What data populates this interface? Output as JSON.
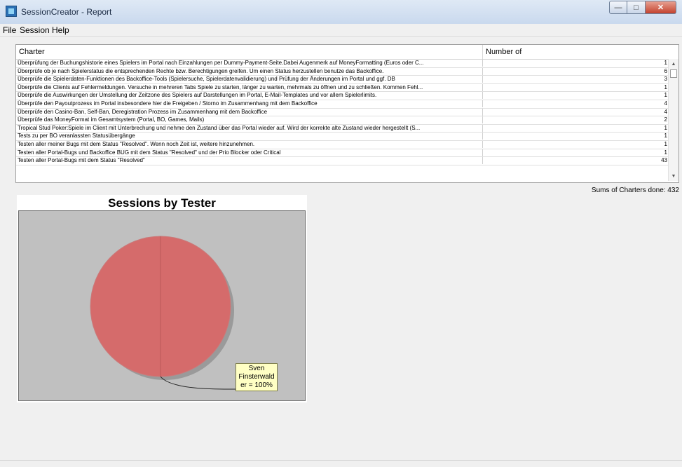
{
  "window": {
    "title": "SessionCreator - Report"
  },
  "menu": {
    "file": "File",
    "session": "Session",
    "help": "Help"
  },
  "table": {
    "headers": {
      "charter": "Charter",
      "number_of": "Number of"
    },
    "rows": [
      {
        "charter": "Überprüfung der Buchungshistorie eines Spielers im Portal nach Einzahlungen per Dummy-Payment-Seite.Dabei Augenmerk auf MoneyFormatting (Euros oder C...",
        "count": "1"
      },
      {
        "charter": "Überprüfe ob je nach Spielerstatus die entsprechenden Rechte bzw. Berechtigungen greifen. Um einen Status herzustellen benutze das Backoffice.",
        "count": "6"
      },
      {
        "charter": "Überprüfe die Spielerdaten-Funktionen des Backoffice-Tools (Spielersuche, Spielerdatenvalidierung) und Prüfung der Änderungen im Portal und ggf. DB",
        "count": "3"
      },
      {
        "charter": "Überprüfe die Clients auf Fehlermeldungen. Versuche in mehreren Tabs Spiele zu starten, länger zu warten, mehrmals zu öffnen und zu schließen. Kommen Fehl...",
        "count": "1"
      },
      {
        "charter": "Überprüfe die Auswirkungen der Umstellung der Zeitzone des Spielers auf Darstellungen im Portal, E-Mail-Templates und vor allem Spielerlimits.",
        "count": "1"
      },
      {
        "charter": "Überprüfe den Payoutprozess im Portal insbesondere hier die Freigeben / Storno im Zusammenhang mit dem Backoffice",
        "count": "4"
      },
      {
        "charter": "Überprüfe den Casino-Ban, Self-Ban, Deregistration Prozess im Zusammenhang mit dem Backoffice",
        "count": "4"
      },
      {
        "charter": "Überprüfe das MoneyFormat im Gesamtsystem (Portal, BO, Games, Mails)",
        "count": "2"
      },
      {
        "charter": "Tropical Stud Poker:Spiele im Client mit Unterbrechung und nehme den Zustand über das Portal wieder auf. Wird der korrekte alte Zustand wieder hergestellt (S...",
        "count": "1"
      },
      {
        "charter": "Tests zu per BO veranlassten Statusübergänge",
        "count": "1"
      },
      {
        "charter": "Testen aller meiner Bugs mit dem Status \"Resolved\". Wenn noch Zeit ist, weitere hinzunehmen.",
        "count": "1"
      },
      {
        "charter": "Testen aller Portal-Bugs und Backoffice BUG mit dem Status \"Resolved\" und der Prio Blocker oder Critical",
        "count": "1"
      },
      {
        "charter": "Testen aller Portal-Bugs mit dem Status \"Resolved\"",
        "count": "43"
      }
    ]
  },
  "summary": {
    "text": "Sums of Charters done: 432"
  },
  "chart_data": {
    "type": "pie",
    "title": "Sessions by Tester",
    "slices": [
      {
        "label": "Sven Finsterwalder",
        "value": 100,
        "unit": "%",
        "color": "#d56b6b"
      }
    ],
    "label_text": [
      "Sven",
      "Finsterwald",
      "er = 100%"
    ],
    "background": "#c0c0c0",
    "label_background": "#ffffc4"
  }
}
